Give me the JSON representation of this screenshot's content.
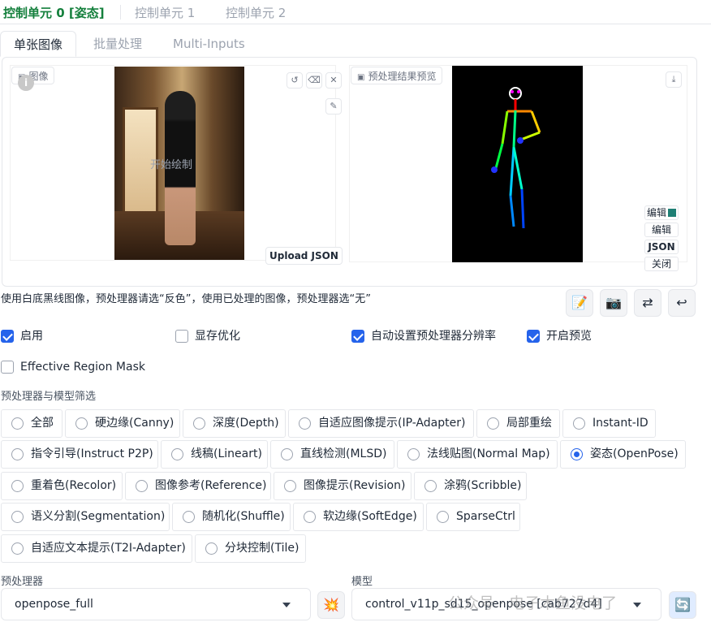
{
  "unit_tabs": [
    "控制单元 0 [姿态]",
    "控制单元 1",
    "控制单元 2"
  ],
  "mode_tabs": [
    "单张图像",
    "批量处理",
    "Multi-Inputs"
  ],
  "image_panel": {
    "input_label": "图像",
    "input_overlay": "开始绘制",
    "upload_json": "Upload JSON",
    "preview_label": "预处理结果预览",
    "side_buttons": [
      "编辑",
      "编辑",
      "JSON",
      "关闭"
    ]
  },
  "hint": "使用白底黑线图像，预处理器请选“反色”，使用已处理的图像，预处理器选“无”",
  "checkboxes": [
    {
      "label": "启用",
      "checked": true
    },
    {
      "label": "显存优化",
      "checked": false
    },
    {
      "label": "自动设置预处理器分辨率",
      "checked": true
    },
    {
      "label": "开启预览",
      "checked": true
    },
    {
      "label": "Effective Region Mask",
      "checked": false
    }
  ],
  "filter_label": "预处理器与模型筛选",
  "filters": [
    {
      "label": "全部",
      "selected": false
    },
    {
      "label": "硬边缘(Canny)",
      "selected": false
    },
    {
      "label": "深度(Depth)",
      "selected": false
    },
    {
      "label": "自适应图像提示(IP-Adapter)",
      "selected": false
    },
    {
      "label": "局部重绘",
      "selected": false
    },
    {
      "label": "Instant-ID",
      "selected": false
    },
    {
      "label": "指令引导(Instruct P2P)",
      "selected": false
    },
    {
      "label": "线稿(Lineart)",
      "selected": false
    },
    {
      "label": "直线检测(MLSD)",
      "selected": false
    },
    {
      "label": "法线贴图(Normal Map)",
      "selected": false
    },
    {
      "label": "姿态(OpenPose)",
      "selected": true
    },
    {
      "label": "重着色(Recolor)",
      "selected": false
    },
    {
      "label": "图像参考(Reference)",
      "selected": false
    },
    {
      "label": "图像提示(Revision)",
      "selected": false
    },
    {
      "label": "涂鸦(Scribble)",
      "selected": false
    },
    {
      "label": "语义分割(Segmentation)",
      "selected": false
    },
    {
      "label": "随机化(Shuffle)",
      "selected": false
    },
    {
      "label": "软边缘(SoftEdge)",
      "selected": false
    },
    {
      "label": "SparseCtrl",
      "selected": false
    },
    {
      "label": "自适应文本提示(T2I-Adapter)",
      "selected": false
    },
    {
      "label": "分块控制(Tile)",
      "selected": false
    }
  ],
  "preprocessor": {
    "label": "预处理器",
    "value": "openpose_full"
  },
  "model": {
    "label": "模型",
    "value": "control_v11p_sd15_openpose [cab727d4]"
  },
  "watermark": "公众号 · 电子木鱼没电了",
  "colors": {
    "active_tab": "#15803d",
    "accent": "#2563eb"
  }
}
